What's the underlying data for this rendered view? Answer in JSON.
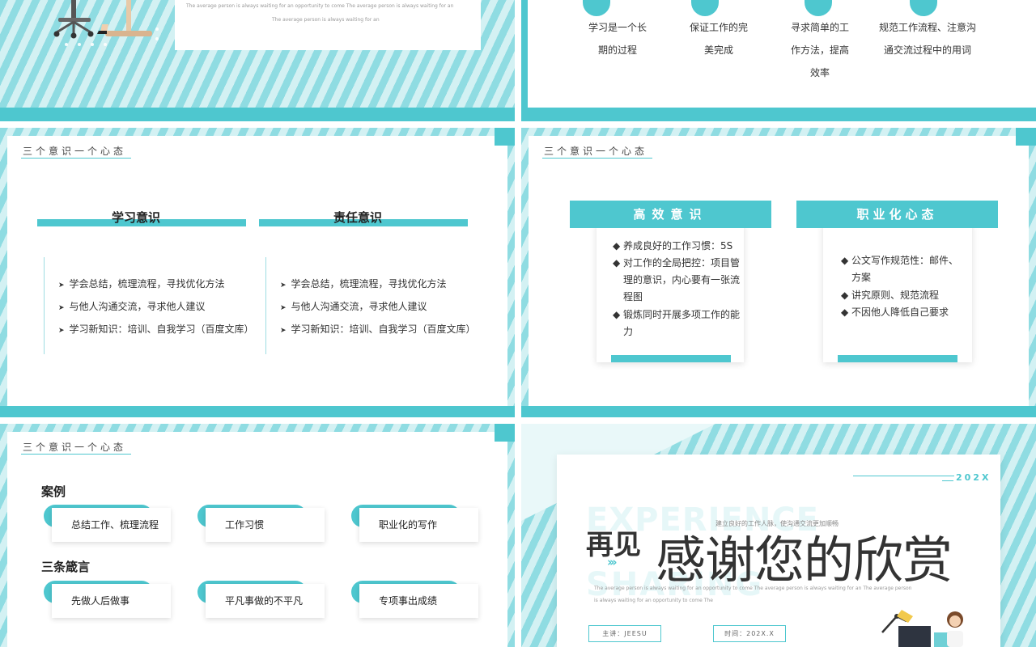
{
  "slide1": {
    "caption_line1": "The average person is always waiting for an opportunity to come The average person is always waiting for an",
    "caption_line2": "The average person is always waiting for an"
  },
  "slide2": {
    "items": [
      "学习是一个长期的过程",
      "保证工作的完美完成",
      "寻求简单的工作方法，提高效率",
      "规范工作流程、注意沟通交流过程中的用词"
    ]
  },
  "section_title": "三个意识一个心态",
  "slide3": {
    "columns": [
      {
        "title": "学习意识",
        "bullets": [
          "学会总结，梳理流程，寻找优化方法",
          "与他人沟通交流，寻求他人建议",
          "学习新知识：培训、自我学习（百度文库）"
        ]
      },
      {
        "title": "责任意识",
        "bullets": [
          "学会总结，梳理流程，寻找优化方法",
          "与他人沟通交流，寻求他人建议",
          "学习新知识：培训、自我学习（百度文库）"
        ]
      }
    ]
  },
  "slide4": {
    "boxes": [
      {
        "title": "高效意识",
        "items": [
          "养成良好的工作习惯：5S",
          "对工作的全局把控：项目管理的意识，内心要有一张流程图",
          "锻炼同时开展多项工作的能力"
        ]
      },
      {
        "title": "职业化心态",
        "items": [
          "公文写作规范性：邮件、方案",
          "讲究原则、规范流程",
          "不因他人降低自己要求"
        ]
      }
    ]
  },
  "slide5": {
    "group1_title": "案例",
    "group1_items": [
      "总结工作、梳理流程",
      "工作习惯",
      "职业化的写作"
    ],
    "group2_title": "三条箴言",
    "group2_items": [
      "先做人后做事",
      "平凡事做的不平凡",
      "专项事出成绩"
    ]
  },
  "slide6": {
    "year": "202X",
    "watermark1": "EXPERIENCE",
    "watermark2": "SHARING",
    "subtitle": "建立良好的工作人脉，使沟通交流更加顺畅",
    "bye": "再见",
    "thanks": "感谢您的欣赏",
    "caption_line1": "The average person is always waiting for an opportunity to come The average person is always waiting for an The average person",
    "caption_line2": "is always waiting for an opportunity to come The",
    "presenter": "主讲：JEESU",
    "time": "时间：202X.X"
  },
  "colors": {
    "accent": "#4ec7cf",
    "stripe_light": "#d3f1f3",
    "stripe_dark": "#8fdce2"
  }
}
